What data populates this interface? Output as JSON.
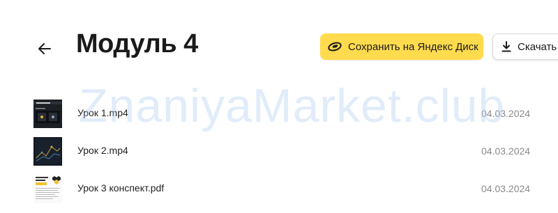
{
  "header": {
    "title": "Модуль 4",
    "save_label": "Сохранить на Яндекс Диск",
    "download_label": "Скачать в",
    "accent_color": "#ffdb4d"
  },
  "watermark": {
    "text": "ZnaniyaMarket.club"
  },
  "files": [
    {
      "name": "Урок 1.mp4",
      "date": "04.03.2024",
      "thumb": "video-thumbnail"
    },
    {
      "name": "Урок 2.mp4",
      "date": "04.03.2024",
      "thumb": "video-thumbnail"
    },
    {
      "name": "Урок 3 конспект.pdf",
      "date": "04.03.2024",
      "thumb": "pdf-thumbnail"
    }
  ]
}
